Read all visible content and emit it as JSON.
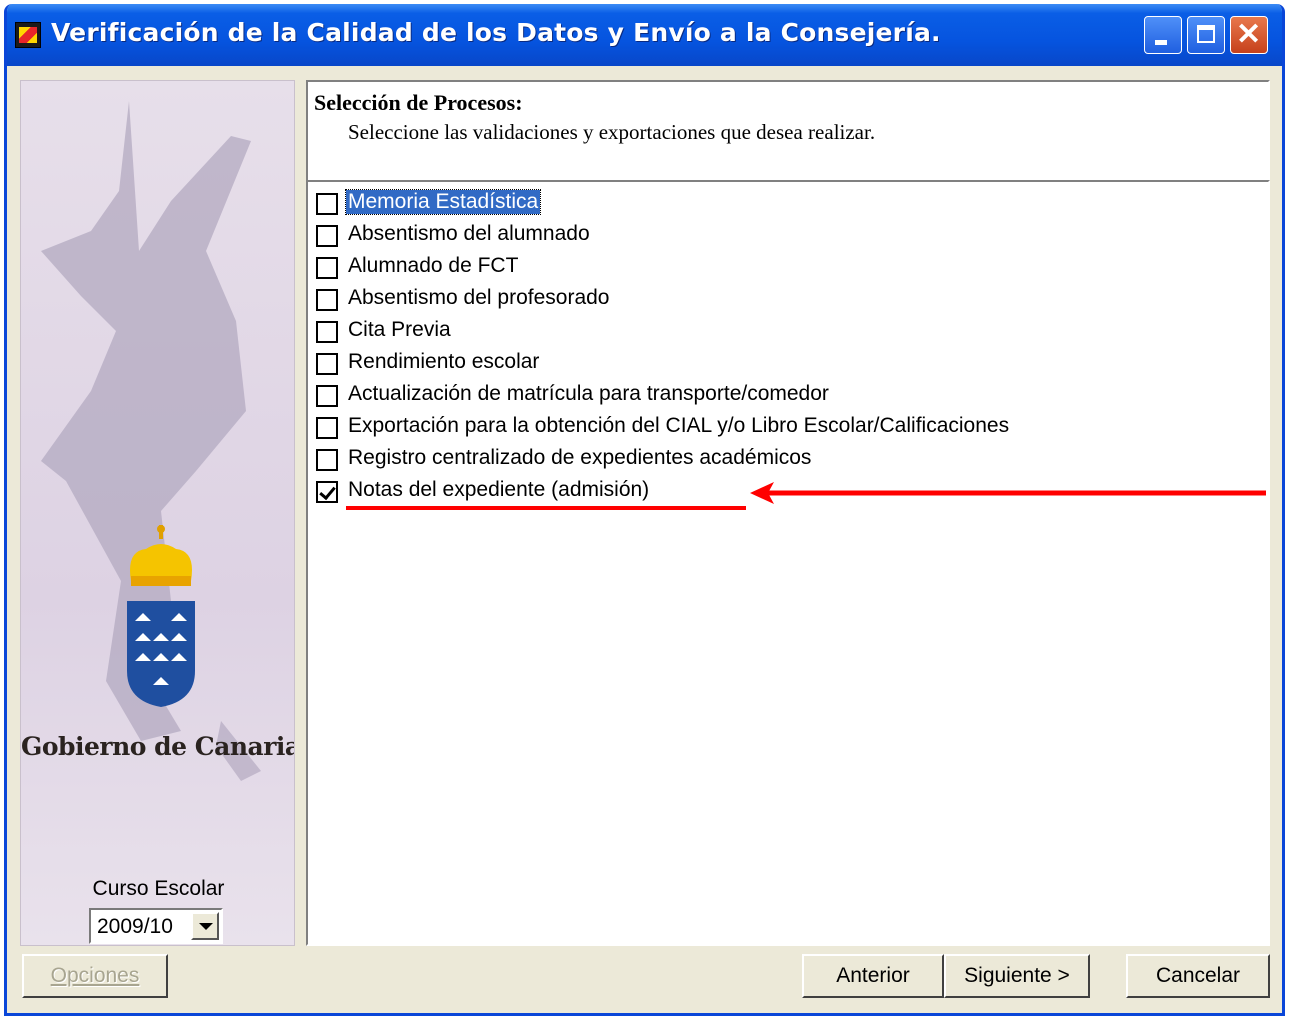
{
  "window": {
    "title": "Verificación de la Calidad de los Datos y Envío a la Consejería."
  },
  "left_panel": {
    "government_name": "Gobierno de Canarias",
    "course_label": "Curso Escolar",
    "course_value": "2009/10"
  },
  "header": {
    "title": "Selección de Procesos:",
    "subtitle": "Seleccione las validaciones y exportaciones que desea realizar."
  },
  "processes": [
    {
      "label": "Memoria Estadística",
      "checked": false,
      "selected": true
    },
    {
      "label": "Absentismo del alumnado",
      "checked": false
    },
    {
      "label": "Alumnado de FCT",
      "checked": false
    },
    {
      "label": "Absentismo del profesorado",
      "checked": false
    },
    {
      "label": "Cita Previa",
      "checked": false
    },
    {
      "label": "Rendimiento escolar",
      "checked": false
    },
    {
      "label": "Actualización de matrícula para transporte/comedor",
      "checked": false
    },
    {
      "label": "Exportación para la obtención del CIAL y/o Libro Escolar/Calificaciones",
      "checked": false
    },
    {
      "label": "Registro centralizado de expedientes académicos",
      "checked": false
    },
    {
      "label": "Notas del expediente (admisión)",
      "checked": true
    }
  ],
  "buttons": {
    "options_label": "Opciones",
    "previous_label": "Anterior",
    "next_label": "Siguiente >",
    "cancel_label": "Cancelar"
  },
  "colors": {
    "annotation": "#ff0000",
    "title_bar": "#0654df",
    "selection": "#316ac5"
  }
}
